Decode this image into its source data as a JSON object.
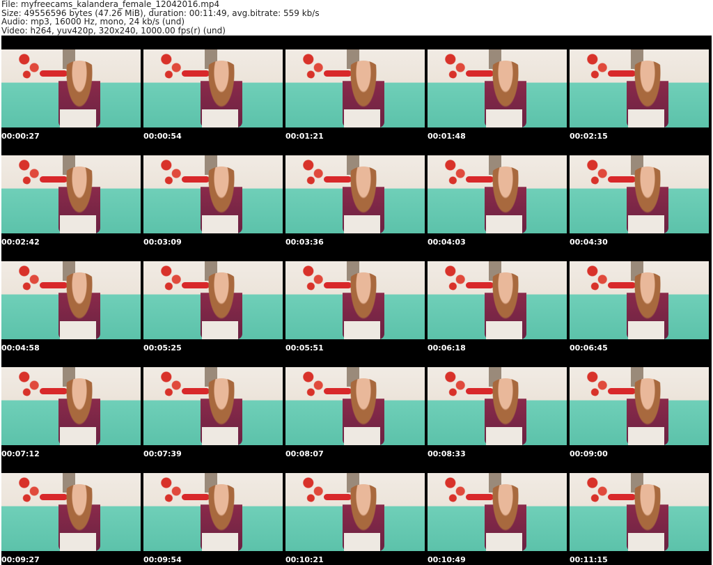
{
  "header": {
    "file": "File: myfreecams_kalandera_female_12042016.mp4",
    "size": "Size: 49556596 bytes (47.26 MiB), duration: 00:11:49, avg.bitrate: 559 kb/s",
    "audio": "Audio: mp3, 16000 Hz, mono, 24 kb/s (und)",
    "video": "Video: h264, yuv420p, 320x240, 1000.00 fps(r) (und)"
  },
  "thumbnails": [
    "00:00:27",
    "00:00:54",
    "00:01:21",
    "00:01:48",
    "00:02:15",
    "00:02:42",
    "00:03:09",
    "00:03:36",
    "00:04:03",
    "00:04:30",
    "00:04:58",
    "00:05:25",
    "00:05:51",
    "00:06:18",
    "00:06:45",
    "00:07:12",
    "00:07:39",
    "00:08:07",
    "00:08:33",
    "00:09:00",
    "00:09:27",
    "00:09:54",
    "00:10:21",
    "00:10:49",
    "00:11:15"
  ]
}
